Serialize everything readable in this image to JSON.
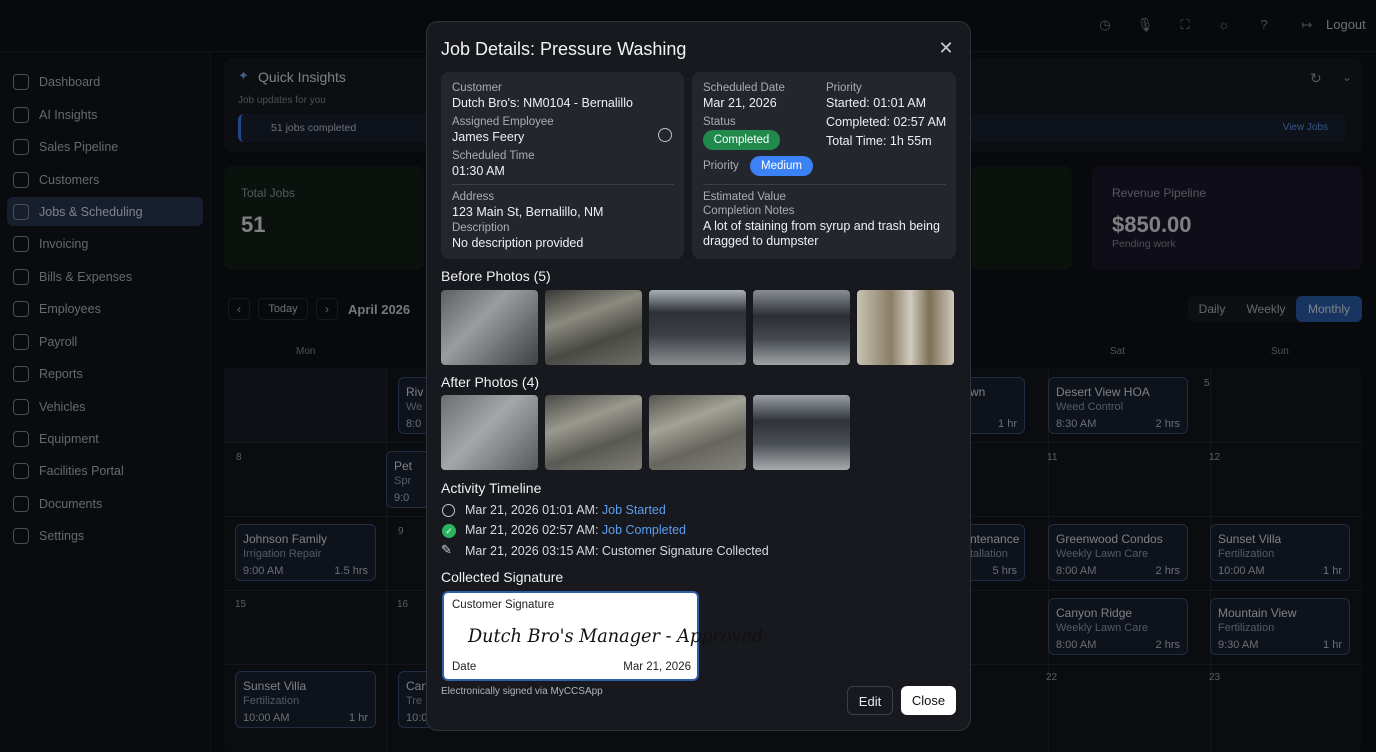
{
  "topbar": {
    "logout": "Logout"
  },
  "sidebar": {
    "items": [
      {
        "label": "Dashboard"
      },
      {
        "label": "AI Insights"
      },
      {
        "label": "Sales Pipeline"
      },
      {
        "label": "Customers"
      },
      {
        "label": "Jobs & Scheduling"
      },
      {
        "label": "Invoicing"
      },
      {
        "label": "Bills & Expenses"
      },
      {
        "label": "Employees"
      },
      {
        "label": "Payroll"
      },
      {
        "label": "Reports"
      },
      {
        "label": "Vehicles"
      },
      {
        "label": "Equipment"
      },
      {
        "label": "Facilities Portal"
      },
      {
        "label": "Documents"
      },
      {
        "label": "Settings"
      }
    ]
  },
  "insights": {
    "title": "Quick Insights",
    "subtitle": "Job updates for you",
    "chip": "51 jobs completed",
    "view_jobs": "View Jobs"
  },
  "stats": {
    "total_jobs_label": "Total Jobs",
    "total_jobs_value": "51",
    "revenue_label": "Revenue Pipeline",
    "revenue_value": "$850.00",
    "revenue_sub": "Pending work"
  },
  "calendar": {
    "today": "Today",
    "month": "April 2026",
    "views": [
      "Daily",
      "Weekly",
      "Monthly"
    ],
    "days": [
      "Mon",
      "Sat",
      "Sun"
    ],
    "day_numbers": [
      "5",
      "8",
      "9",
      "11",
      "12",
      "15",
      "16",
      "22",
      "23"
    ],
    "events": [
      {
        "title": "Desert View HOA",
        "service": "Weed Control",
        "time": "8:30 AM",
        "duration": "2 hrs"
      },
      {
        "title": "Johnson Family",
        "service": "Irrigation Repair",
        "time": "9:00 AM",
        "duration": "1.5 hrs"
      },
      {
        "title": "Greenwood Condos",
        "service": "Weekly Lawn Care",
        "time": "8:00 AM",
        "duration": "2 hrs"
      },
      {
        "title": "Sunset Villa",
        "service": "Fertilization",
        "time": "10:00 AM",
        "duration": "1 hr"
      },
      {
        "title": "Canyon Ridge",
        "service": "Weekly Lawn Care",
        "time": "8:00 AM",
        "duration": "2 hrs"
      },
      {
        "title": "Mountain View",
        "service": "Fertilization",
        "time": "9:30 AM",
        "duration": "1 hr"
      },
      {
        "title": "Sunset Villa",
        "service": "Fertilization",
        "time": "10:00 AM",
        "duration": "1 hr"
      }
    ],
    "partial": [
      {
        "t": "Riv",
        "s": "We",
        "tm": "8:0"
      },
      {
        "t": "Pet",
        "s": "Spr",
        "tm": "9:0"
      },
      {
        "t": "Can",
        "s": "Tre",
        "tm": "10:0"
      },
      {
        "t": "wn",
        "du": "1 hr"
      },
      {
        "t": "ntenance",
        "s": "tallation",
        "du": "5 hrs"
      }
    ]
  },
  "modal": {
    "title": "Job Details: Pressure Washing",
    "customer_label": "Customer",
    "customer": "Dutch Bro's: NM0104 - Bernalillo",
    "employee_label": "Assigned Employee",
    "employee": "James Feery",
    "sched_time_label": "Scheduled Time",
    "sched_time": "01:30 AM",
    "address_label": "Address",
    "address": "123 Main St, Bernalillo, NM",
    "desc_label": "Description",
    "desc": "No description provided",
    "sched_date_label": "Scheduled Date",
    "sched_date": "Mar 21, 2026",
    "priority_label": "Priority",
    "started": "Started: 01:01 AM",
    "status_label": "Status",
    "status": "Completed",
    "completed": "Completed: 02:57 AM",
    "total_time": "Total Time: 1h 55m",
    "priority2_label": "Priority",
    "priority": "Medium",
    "est_label": "Estimated Value",
    "notes_label": "Completion Notes",
    "notes": "A lot of staining from syrup and trash being dragged to dumpster",
    "before_title": "Before Photos (5)",
    "after_title": "After Photos (4)",
    "timeline_title": "Activity Timeline",
    "timeline": [
      {
        "time": "Mar 21, 2026 01:01 AM:",
        "event": "Job Started"
      },
      {
        "time": "Mar 21, 2026 02:57 AM:",
        "event": "Job Completed"
      },
      {
        "time": "Mar 21, 2026 03:15 AM:",
        "event": "Customer Signature Collected"
      }
    ],
    "signature_title": "Collected Signature",
    "sig_label": "Customer Signature",
    "sig_text": "Dutch Bro's Manager - Approved",
    "sig_date_label": "Date",
    "sig_date": "Mar 21, 2026",
    "sig_note": "Electronically signed via MyCCSApp",
    "edit": "Edit",
    "close": "Close"
  },
  "colors": {
    "accent": "#3b82f6",
    "completed": "#1f8a4c",
    "medium": "#3b82f6",
    "active_nav": "#2b3a57"
  }
}
